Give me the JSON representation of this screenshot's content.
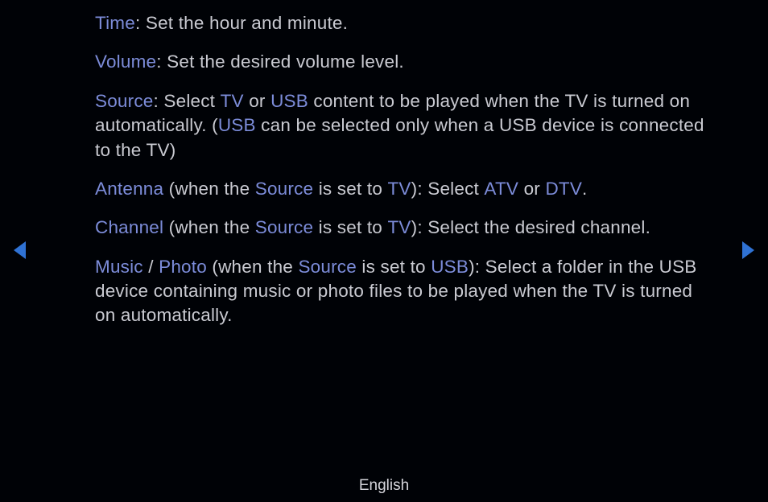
{
  "items": {
    "time": {
      "label": "Time",
      "desc": ": Set the hour and minute."
    },
    "volume": {
      "label": "Volume",
      "desc": ": Set the desired volume level."
    },
    "source": {
      "label": "Source",
      "p1": ": Select ",
      "tv": "TV",
      "p2": " or ",
      "usb1": "USB",
      "p3": " content to be played when the TV is turned on automatically. (",
      "usb2": "USB",
      "p4": " can be selected only when a USB device is connected to the TV)"
    },
    "antenna": {
      "label": "Antenna",
      "p1": " (when the ",
      "src": "Source",
      "p2": " is set to ",
      "tv": "TV",
      "p3": "): Select ",
      "atv": "ATV",
      "p4": " or ",
      "dtv": "DTV",
      "p5": "."
    },
    "channel": {
      "label": "Channel",
      "p1": " (when the ",
      "src": "Source",
      "p2": " is set to ",
      "tv": "TV",
      "p3": "): Select the desired channel."
    },
    "media": {
      "music": "Music",
      "sep": " / ",
      "photo": "Photo",
      "p1": " (when the ",
      "src": "Source",
      "p2": " is set to ",
      "usb": "USB",
      "p3": "): Select a folder in the USB device containing music or photo files to be played when the TV is turned on automatically."
    }
  },
  "footer": {
    "language": "English"
  }
}
